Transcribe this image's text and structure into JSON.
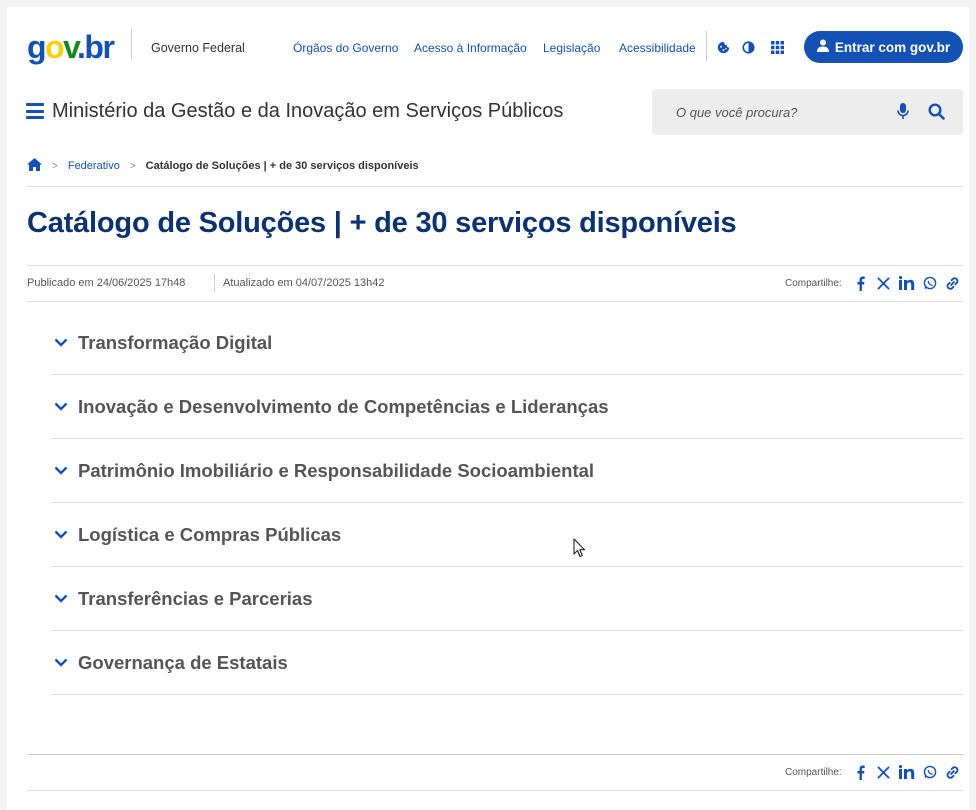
{
  "header": {
    "logo": {
      "g": "g",
      "o": "o",
      "v": "v",
      "dot": ".",
      "b": "b",
      "r": "r"
    },
    "gov_label": "Governo Federal",
    "links": [
      "Órgãos do Governo",
      "Acesso à Informação",
      "Legislação",
      "Acessibilidade"
    ],
    "icons": [
      "cookie-icon",
      "contrast-icon",
      "apps-grid-icon"
    ],
    "login_label": "Entrar com gov.br",
    "ministry": "Ministério da Gestão e da Inovação em Serviços Públicos",
    "search_placeholder": "O que você procura?"
  },
  "breadcrumb": {
    "home": "home-icon",
    "items": [
      "Federativo",
      "Catálogo de Soluções | + de 30 serviços disponíveis"
    ]
  },
  "page": {
    "title": "Catálogo de Soluções | + de 30 serviços disponíveis",
    "published": "Publicado em 24/06/2025 17h48",
    "updated": "Atualizado em 04/07/2025 13h42",
    "share_label": "Compartilhe:",
    "share_icons": [
      "facebook-icon",
      "x-icon",
      "linkedin-icon",
      "whatsapp-icon",
      "link-icon"
    ]
  },
  "accordion": [
    "Transformação Digital",
    "Inovação e Desenvolvimento de Competências e Lideranças",
    "Patrimônio Imobiliário e Responsabilidade Socioambiental",
    "Logística e Compras Públicas",
    "Transferências e Parcerias",
    "Governança de Estatais"
  ],
  "footer": {
    "share_label": "Compartilhe:"
  },
  "colors": {
    "primary": "#1351b4",
    "title": "#0c326f",
    "yellow": "#ffcd07",
    "green": "#168821"
  }
}
